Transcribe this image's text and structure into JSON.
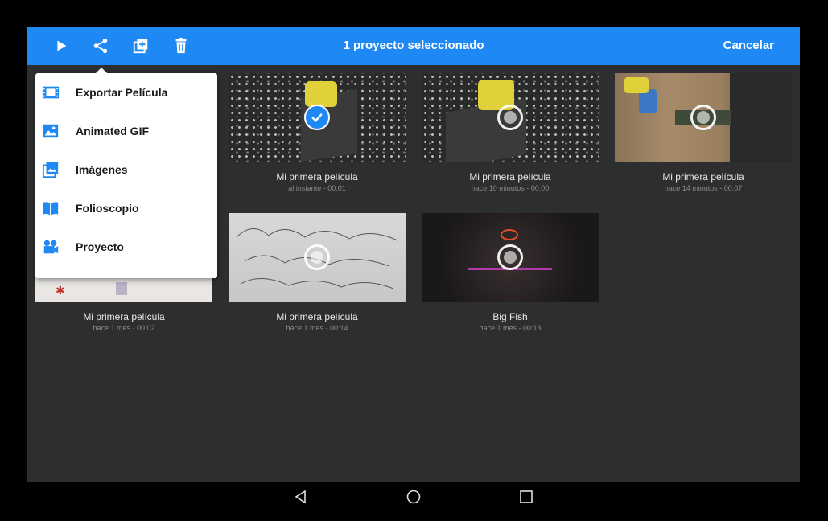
{
  "topbar": {
    "title": "1 proyecto seleccionado",
    "cancel_label": "Cancelar",
    "icons": [
      "play-icon",
      "share-icon",
      "duplicate-icon",
      "trash-icon"
    ]
  },
  "share_menu": {
    "items": [
      {
        "label": "Exportar Película",
        "icon": "film-icon"
      },
      {
        "label": "Animated GIF",
        "icon": "image-icon"
      },
      {
        "label": "Imágenes",
        "icon": "images-icon"
      },
      {
        "label": "Folioscopio",
        "icon": "book-icon"
      },
      {
        "label": "Proyecto",
        "icon": "camera-icon"
      }
    ]
  },
  "projects": [
    {
      "title": "Mi primera película",
      "subtitle": "al instante - 00:01",
      "selected": true
    },
    {
      "title": "Mi primera película",
      "subtitle": "hace 10 minutos - 00:00",
      "selected": false
    },
    {
      "title": "Mi primera película",
      "subtitle": "hace 14 minutos - 00:07",
      "selected": false
    },
    {
      "title": "Mi primera película",
      "subtitle": "hace 1 mes - 00:02",
      "selected": false
    },
    {
      "title": "Mi primera película",
      "subtitle": "hace 1 mes - 00:14",
      "selected": false
    },
    {
      "title": "Big Fish",
      "subtitle": "hace 1 mes - 00:13",
      "selected": false
    }
  ],
  "colors": {
    "accent": "#1e88f5",
    "background": "#2d2e30",
    "card_title": "#e8e8e8",
    "card_subtitle": "#8a8b8d"
  }
}
